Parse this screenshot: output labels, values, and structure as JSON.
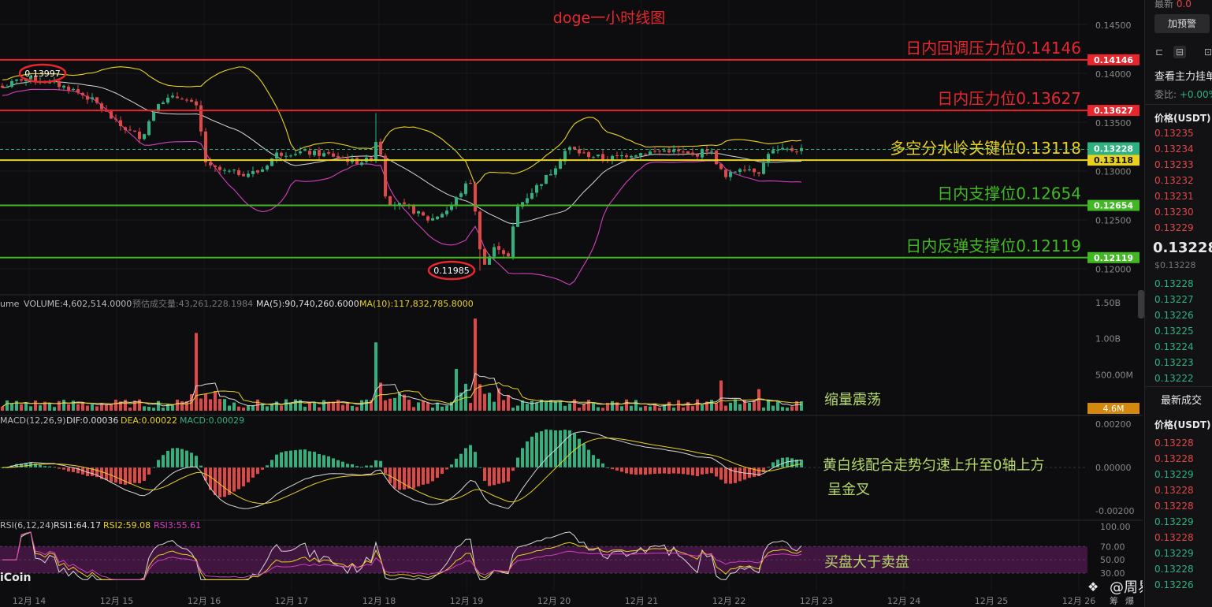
{
  "chart_title": "doge一小时线图",
  "overlay_levels": [
    {
      "label": "日内回调压力位0.14146",
      "price": 0.14146,
      "tag": "0.14146",
      "color": "#e8262e"
    },
    {
      "label": "日内压力位0.13627",
      "price": 0.13627,
      "tag": "0.13627",
      "color": "#e8262e"
    },
    {
      "label": "多空分水岭关键位0.13118",
      "price": 0.13118,
      "tag": "0.13118",
      "color": "#e8d21e"
    },
    {
      "label": "日内支撑位0.12654",
      "price": 0.12654,
      "tag": "0.12654",
      "color": "#42b824"
    },
    {
      "label": "日内反弹支撑位0.12119",
      "price": 0.12119,
      "tag": "0.12119",
      "color": "#42b824"
    }
  ],
  "current_price_tag": "0.13228",
  "high_marker": "0.13997",
  "low_marker": "0.11985",
  "price_axis_ticks": [
    "0.14500",
    "0.14000",
    "0.13500",
    "0.13000",
    "0.12500",
    "0.12000"
  ],
  "volume_header": {
    "name": "ume",
    "volume": "VOLUME:4,602,514.0000",
    "estimate": "预估成交量:43,261,228.1984",
    "ma5": "MA(5):90,740,260.6000",
    "ma10": "MA(10):117,832,785.8000"
  },
  "volume_axis_ticks": [
    "1.50B",
    "1.00B",
    "500.00M"
  ],
  "volume_tag": "4.6M",
  "volume_note": "缩量震荡",
  "macd_header": {
    "name": "MACD(12,26,9)",
    "dif": "DIF:0.00036",
    "dea": "DEA:0.00022",
    "macd": "MACD:0.00029"
  },
  "macd_axis_ticks": [
    "0.00200",
    "0.00000",
    "-0.00200"
  ],
  "macd_note_line1": "黄白线配合走势匀速上升至0轴上方",
  "macd_note_line2": "呈金叉",
  "rsi_header": {
    "name": "RSI(6,12,24)",
    "rsi1": "RSI1:64.17",
    "rsi2": "RSI2:59.08",
    "rsi3": "RSI3:55.61"
  },
  "rsi_axis_ticks": [
    "100.00",
    "70.00",
    "50.00",
    "30.00"
  ],
  "rsi_note": "买盘大于卖盘",
  "watermark_left": "iCoin",
  "watermark_right": "@周易趋势",
  "date_labels": [
    "12月 14",
    "12月 15",
    "12月 16",
    "12月 17",
    "12月 18",
    "12月 19",
    "12月 20",
    "12月 21",
    "12月 22",
    "12月 23",
    "12月 24",
    "12月 25",
    "12月 26"
  ],
  "bottom_right_icons": [
    "筹",
    "爆"
  ],
  "sidebar": {
    "top_partial": "最新",
    "top_partial_value": "0.0",
    "alert_button": "加预警",
    "main_orders_title": "查看主力挂单",
    "ratio_label": "委比:",
    "ratio_value": "+0.00%",
    "price_header": "价格(USDT)",
    "asks": [
      "0.13235",
      "0.13234",
      "0.13233",
      "0.13232",
      "0.13231",
      "0.13230",
      "0.13229"
    ],
    "last_price": "0.13228",
    "last_price_sub": "$0.13228",
    "bids": [
      "0.13228",
      "0.13227",
      "0.13226",
      "0.13225",
      "0.13224",
      "0.13223",
      "0.13222"
    ],
    "trades_title": "最新成交",
    "trades_header": "价格(USDT)",
    "trades": [
      {
        "price": "0.13228",
        "side": "sell"
      },
      {
        "price": "0.13228",
        "side": "sell"
      },
      {
        "price": "0.13229",
        "side": "buy"
      },
      {
        "price": "0.13228",
        "side": "sell"
      },
      {
        "price": "0.13228",
        "side": "sell"
      },
      {
        "price": "0.13229",
        "side": "buy"
      },
      {
        "price": "0.13228",
        "side": "sell"
      },
      {
        "price": "0.13229",
        "side": "buy"
      },
      {
        "price": "0.13228",
        "side": "buy"
      },
      {
        "price": "0.13226",
        "side": "buy"
      }
    ]
  },
  "colors": {
    "up": "#2fb27f",
    "down": "#e04848",
    "ma_yellow": "#e8d21e",
    "ma_white": "#d8d8d8",
    "boll_magenta": "#d43fc0",
    "rsi_band": "#4a1748"
  }
}
